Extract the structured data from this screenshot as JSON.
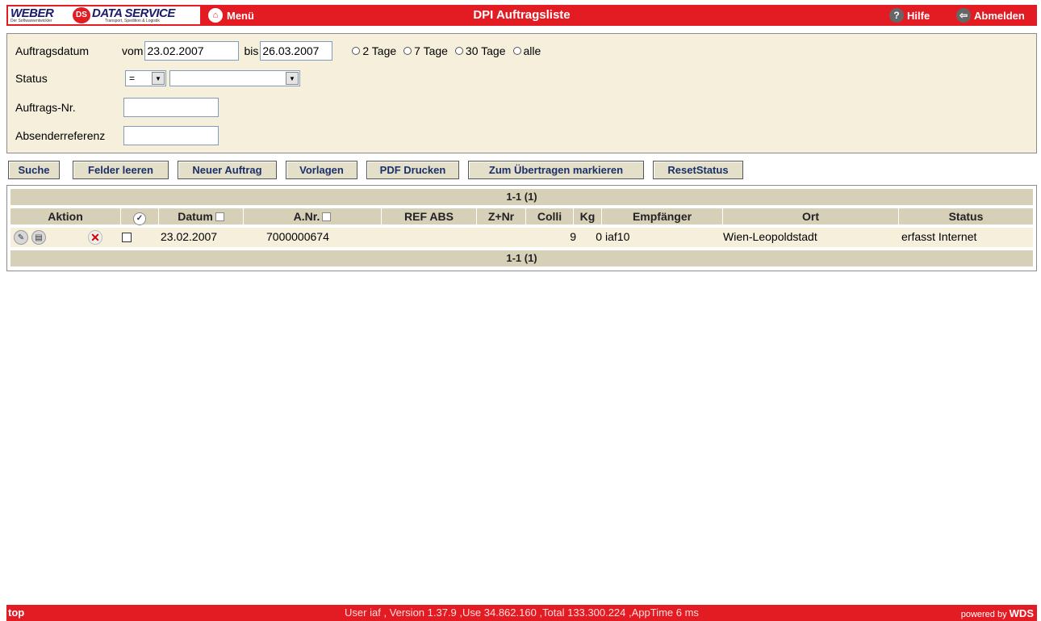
{
  "header": {
    "logo": {
      "part1": "WEBER",
      "badge": "DS",
      "part2": "DATA SERVICE",
      "tagline_left": "Der Softwareentwickler",
      "tagline_right": "Transport, Spedition & Logistik"
    },
    "menu_label": "Menü",
    "title": "DPI Auftragsliste",
    "help_label": "Hilfe",
    "logout_label": "Abmelden"
  },
  "filter": {
    "date_label": "Auftragsdatum",
    "from_label": "vom",
    "from_value": "23.02.2007",
    "to_label": "bis",
    "to_value": "26.03.2007",
    "range_options": [
      "2 Tage",
      "7 Tage",
      "30 Tage",
      "alle"
    ],
    "status_label": "Status",
    "status_operator": "=",
    "status_value": "",
    "order_no_label": "Auftrags-Nr.",
    "order_no_value": "",
    "sender_ref_label": "Absenderreferenz",
    "sender_ref_value": ""
  },
  "buttons": [
    "Suche",
    "Felder leeren",
    "Neuer Auftrag",
    "Vorlagen",
    "PDF Drucken",
    "Zum Übertragen markieren",
    "ResetStatus"
  ],
  "table": {
    "pager": "1-1 (1)",
    "columns": [
      "Aktion",
      "",
      "Datum",
      "A.Nr.",
      "REF ABS",
      "Z+Nr",
      "Colli",
      "Kg",
      "Empfänger",
      "Ort",
      "Status"
    ],
    "rows": [
      {
        "datum": "23.02.2007",
        "anr": "7000000674",
        "ref_abs": "",
        "znr": "",
        "colli": "9",
        "kg": "0",
        "empfaenger": "iaf10",
        "ort": "Wien-Leopoldstadt",
        "status": "erfasst Internet"
      }
    ]
  },
  "footer": {
    "top_link": "top",
    "info": "User iaf , Version 1.37.9 ,Use 34.862.160 ,Total 133.300.224 ,AppTime 6 ms",
    "powered_prefix": "powered by",
    "powered_brand": "WDS"
  },
  "colors": {
    "brand_red": "#e31b23",
    "panel_beige": "#f5efdc",
    "header_tan": "#d6d0b8",
    "button_text": "#1a2f6b"
  },
  "icons": [
    "home-icon",
    "help-icon",
    "logout-icon",
    "edit-icon",
    "print-icon",
    "delete-icon",
    "check-all-icon"
  ]
}
